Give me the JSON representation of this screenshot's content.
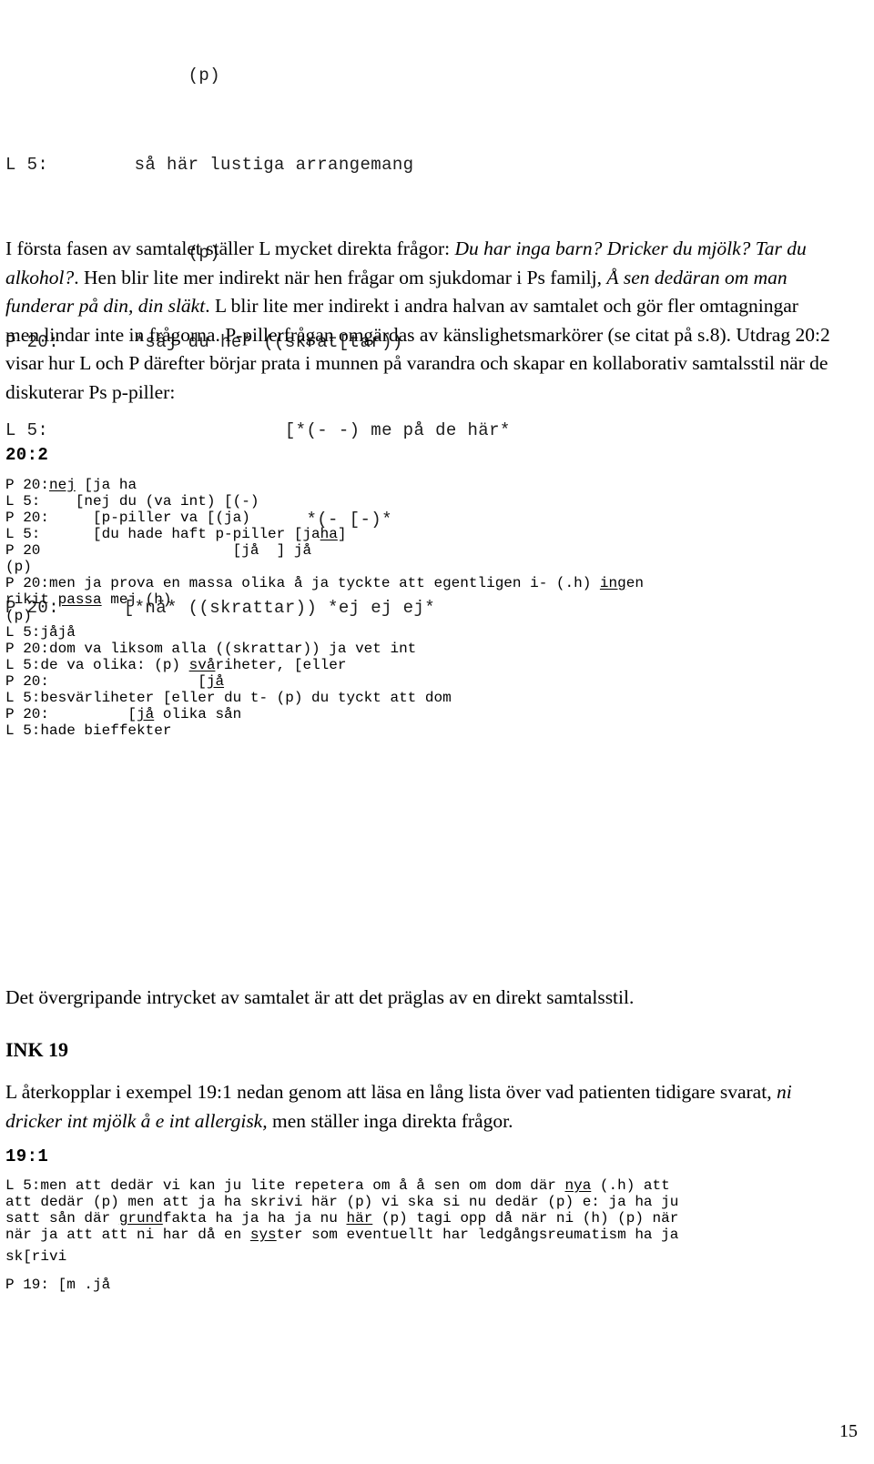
{
  "document": {
    "page_number": "15",
    "language": "sv"
  },
  "excerpt_top": {
    "lines": [
      "                 (p)",
      "L 5:        så här lustiga arrangemang",
      "                 (p)",
      "P 20:       *säj du he* ((skrat[tar))",
      "L 5:                      [*(- -) me på de här*",
      "                            *(- [-)*",
      "P 20:      [*nä* ((skrattar)) *ej ej ej*"
    ]
  },
  "paragraph_1": {
    "segments": [
      {
        "text": "I första fasen av samtalet ställer L mycket direkta frågor: ",
        "style": "roman"
      },
      {
        "text": "Du har inga barn? Dricker du mjölk? Tar du alkohol?",
        "style": "italic"
      },
      {
        "text": ". Hen blir lite mer indirekt när hen frågar om sjukdomar i Ps familj, ",
        "style": "roman"
      },
      {
        "text": "Å sen dedäran om man funderar på din, din släkt",
        "style": "italic"
      },
      {
        "text": ". L blir lite mer indirekt i andra halvan av samtalet och gör fler omtagningar men lindar inte in frågorna. P-pillerfrågan omgärdas av känslighetsmarkörer (se citat på s.8). Utdrag 20:2 visar hur L och P därefter börjar prata i munnen på varandra och skapar en kollaborativ samtalsstil när de diskuterar Ps p-piller:",
        "style": "roman"
      }
    ]
  },
  "excerpt_20_2": {
    "label": "20:2",
    "lines": [
      {
        "prefix": "P 20:",
        "body": "nej [ja ha",
        "underline": "nej"
      },
      {
        "prefix": "L 5:   ",
        "body": " [nej du (va int) [(-)",
        "underline": null
      },
      {
        "prefix": "P 20:  ",
        "body": "   [p-piller va [(ja)",
        "underline": null
      },
      {
        "prefix": "L 5:   ",
        "body": "   [du hade haft p-piller [jaha]",
        "underline": "ha"
      },
      {
        "prefix": "P 20   ",
        "body": "                   [jå  ] jå",
        "underline": null
      },
      {
        "prefix": "",
        "body": "(p)",
        "underline": null
      },
      {
        "prefix": "P 20:",
        "body": "men ja prova en massa olika å ja tyckte att egentligen i- (.h) ingen",
        "underline": "ing"
      },
      {
        "prefix": "",
        "body": "rikit passa mej (h)",
        "underline": "passa"
      },
      {
        "prefix": "",
        "body": "(p)",
        "underline": null
      },
      {
        "prefix": "L 5:",
        "body": "jåjå",
        "underline": null
      },
      {
        "prefix": "P 20:",
        "body": "dom va liksom alla ((skrattar)) ja vet int",
        "underline": null
      },
      {
        "prefix": "L 5:",
        "body": "de va olika: (p) svåriheter, [eller",
        "underline": "svå"
      },
      {
        "prefix": "P 20:",
        "body": "                [jå",
        "underline": "jå"
      },
      {
        "prefix": "L 5:",
        "body": "besvärliheter [eller du t- (p) du tyckt att dom",
        "underline": null
      },
      {
        "prefix": "P 20:",
        "body": "          [jå olika sån",
        "underline": "jå"
      },
      {
        "prefix": "L 5:",
        "body": "hade bieffekter",
        "underline": null
      }
    ]
  },
  "paragraph_2": {
    "text": "Det övergripande intrycket av samtalet är att det präglas av en direkt samtalsstil."
  },
  "heading_ink19": {
    "text": "INK 19"
  },
  "paragraph_3": {
    "segments": [
      {
        "text": "L återkopplar i exempel 19:1 nedan genom att läsa en lång lista över vad patienten tidigare svarat, ",
        "style": "roman"
      },
      {
        "text": "ni dricker int mjölk å e int allergisk,",
        "style": "italic"
      },
      {
        "text": " men ställer inga direkta frågor.",
        "style": "roman"
      }
    ]
  },
  "excerpt_19_1": {
    "label": "19:1",
    "lines": [
      "L 5:men att dedär vi kan ju lite repetera om å å sen om dom där nya (.h) att",
      "att dedär (p) men att ja ha skrivi här (p) vi ska si nu dedär (p) e: ja ha ju",
      "satt sån där grundfakta ha ja ha ja nu här (p) tagi opp då när ni (h) (p) när",
      "när ja att att ni har då en syster som eventuellt har ledgångsreumatism ha ja",
      "sk[rivi",
      "P 19: [m .jå"
    ]
  }
}
